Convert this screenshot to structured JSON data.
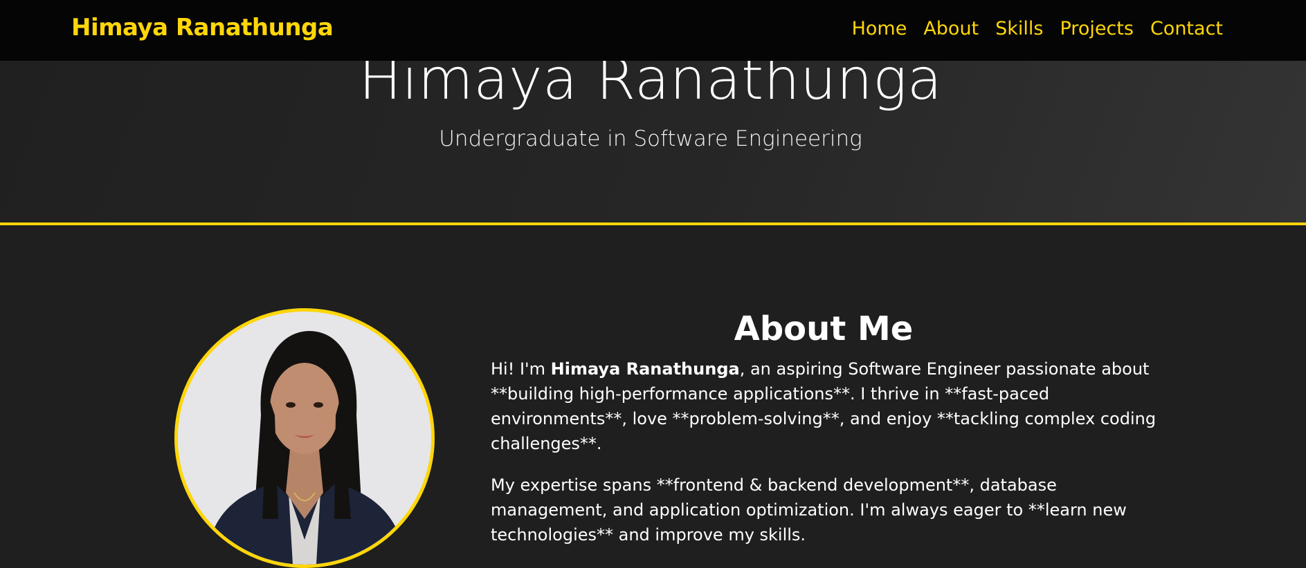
{
  "navbar": {
    "brand": "Himaya Ranathunga",
    "links": [
      "Home",
      "About",
      "Skills",
      "Projects",
      "Contact"
    ]
  },
  "hero": {
    "title": "Himaya Ranathunga",
    "subtitle": "Undergraduate in Software Engineering"
  },
  "about": {
    "title": "About Me",
    "p1_start": "Hi! I'm ",
    "p1_name": "Himaya Ranathunga",
    "p1_rest": ", an aspiring Software Engineer passionate about **building high-performance applications**. I thrive in **fast-paced environments**, love **problem-solving**, and enjoy **tackling complex coding challenges**.",
    "p2": "My expertise spans **frontend & backend development**, database management, and application optimization. I'm always eager to **learn new technologies** and improve my skills."
  },
  "colors": {
    "accent": "#ffd60a",
    "navbar_bg": "#050505",
    "page_bg": "#1e1e1e"
  }
}
